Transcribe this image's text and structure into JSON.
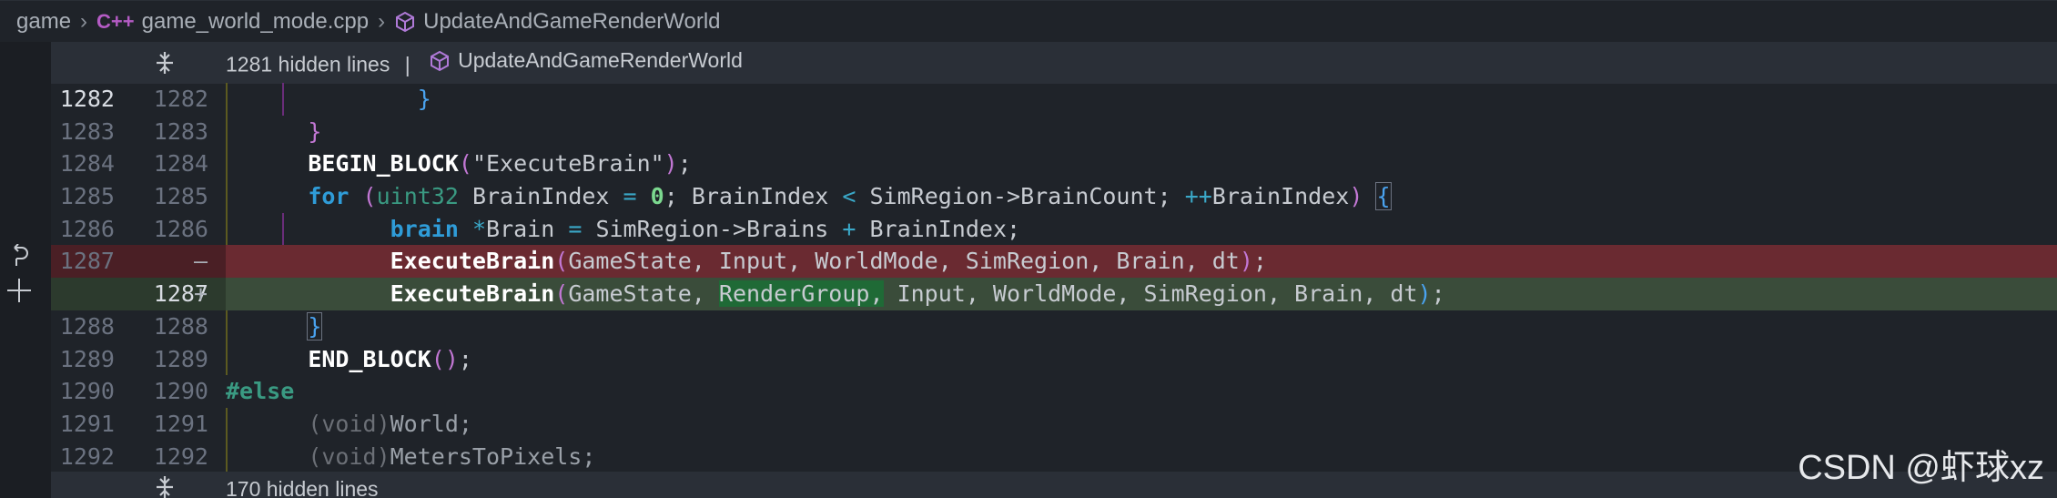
{
  "breadcrumb": {
    "folder": "game",
    "lang_badge": "C++",
    "file": "game_world_mode.cpp",
    "symbol": "UpdateAndGameRenderWorld"
  },
  "banner_top": {
    "text": "1281 hidden lines",
    "separator": "|",
    "symbol": "UpdateAndGameRenderWorld"
  },
  "banner_bottom": {
    "text": "170 hidden lines"
  },
  "lines": [
    {
      "l": "1282",
      "r": "1282"
    },
    {
      "l": "1283",
      "r": "1283"
    },
    {
      "l": "1284",
      "r": "1284"
    },
    {
      "l": "1285",
      "r": "1285"
    },
    {
      "l": "1286",
      "r": "1286"
    },
    {
      "l": "1287",
      "r": "",
      "marker": "—"
    },
    {
      "l": "",
      "r": "1287",
      "marker": "+"
    },
    {
      "l": "1288",
      "r": "1288"
    },
    {
      "l": "1289",
      "r": "1289"
    },
    {
      "l": "1290",
      "r": "1290"
    },
    {
      "l": "1291",
      "r": "1291"
    },
    {
      "l": "1292",
      "r": "1292"
    }
  ],
  "watermark": "CSDN @虾球xz",
  "colors": {
    "deleted": "#4a1f25",
    "added": "#2c3a2d",
    "accent": "#2f9cd8"
  }
}
